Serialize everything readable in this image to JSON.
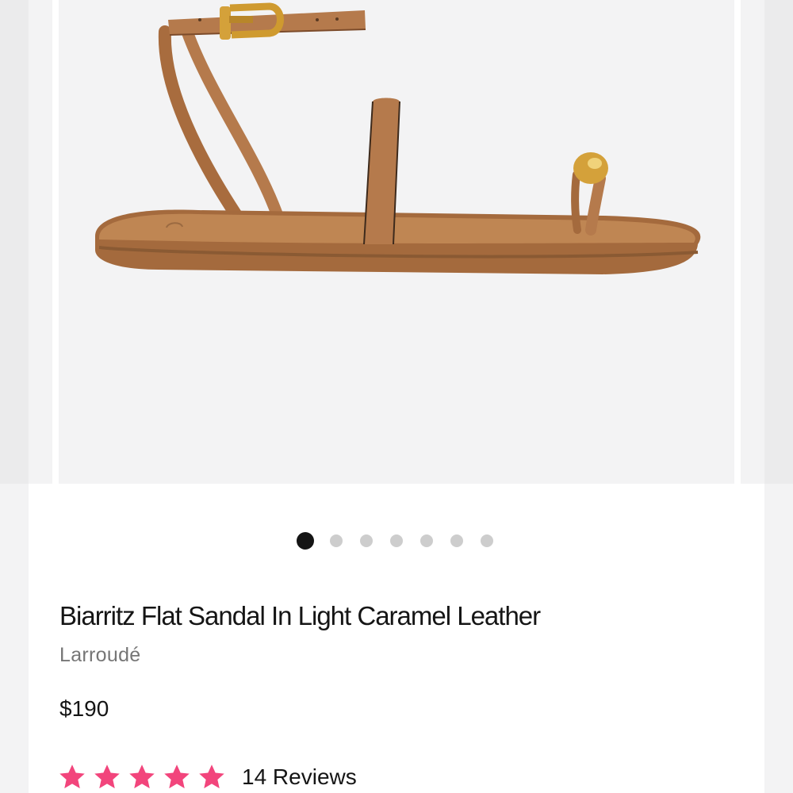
{
  "product": {
    "name": "Biarritz Flat Sandal In Light Caramel Leather",
    "brand": "Larroudé",
    "price": "$190",
    "rating": 5,
    "reviews_label": "14 Reviews",
    "colors": {
      "leather": "#b57a4c",
      "hardware": "#d4a13a",
      "star": "#f2457c"
    }
  },
  "carousel": {
    "slide_count": 7,
    "active_slide": 1
  }
}
